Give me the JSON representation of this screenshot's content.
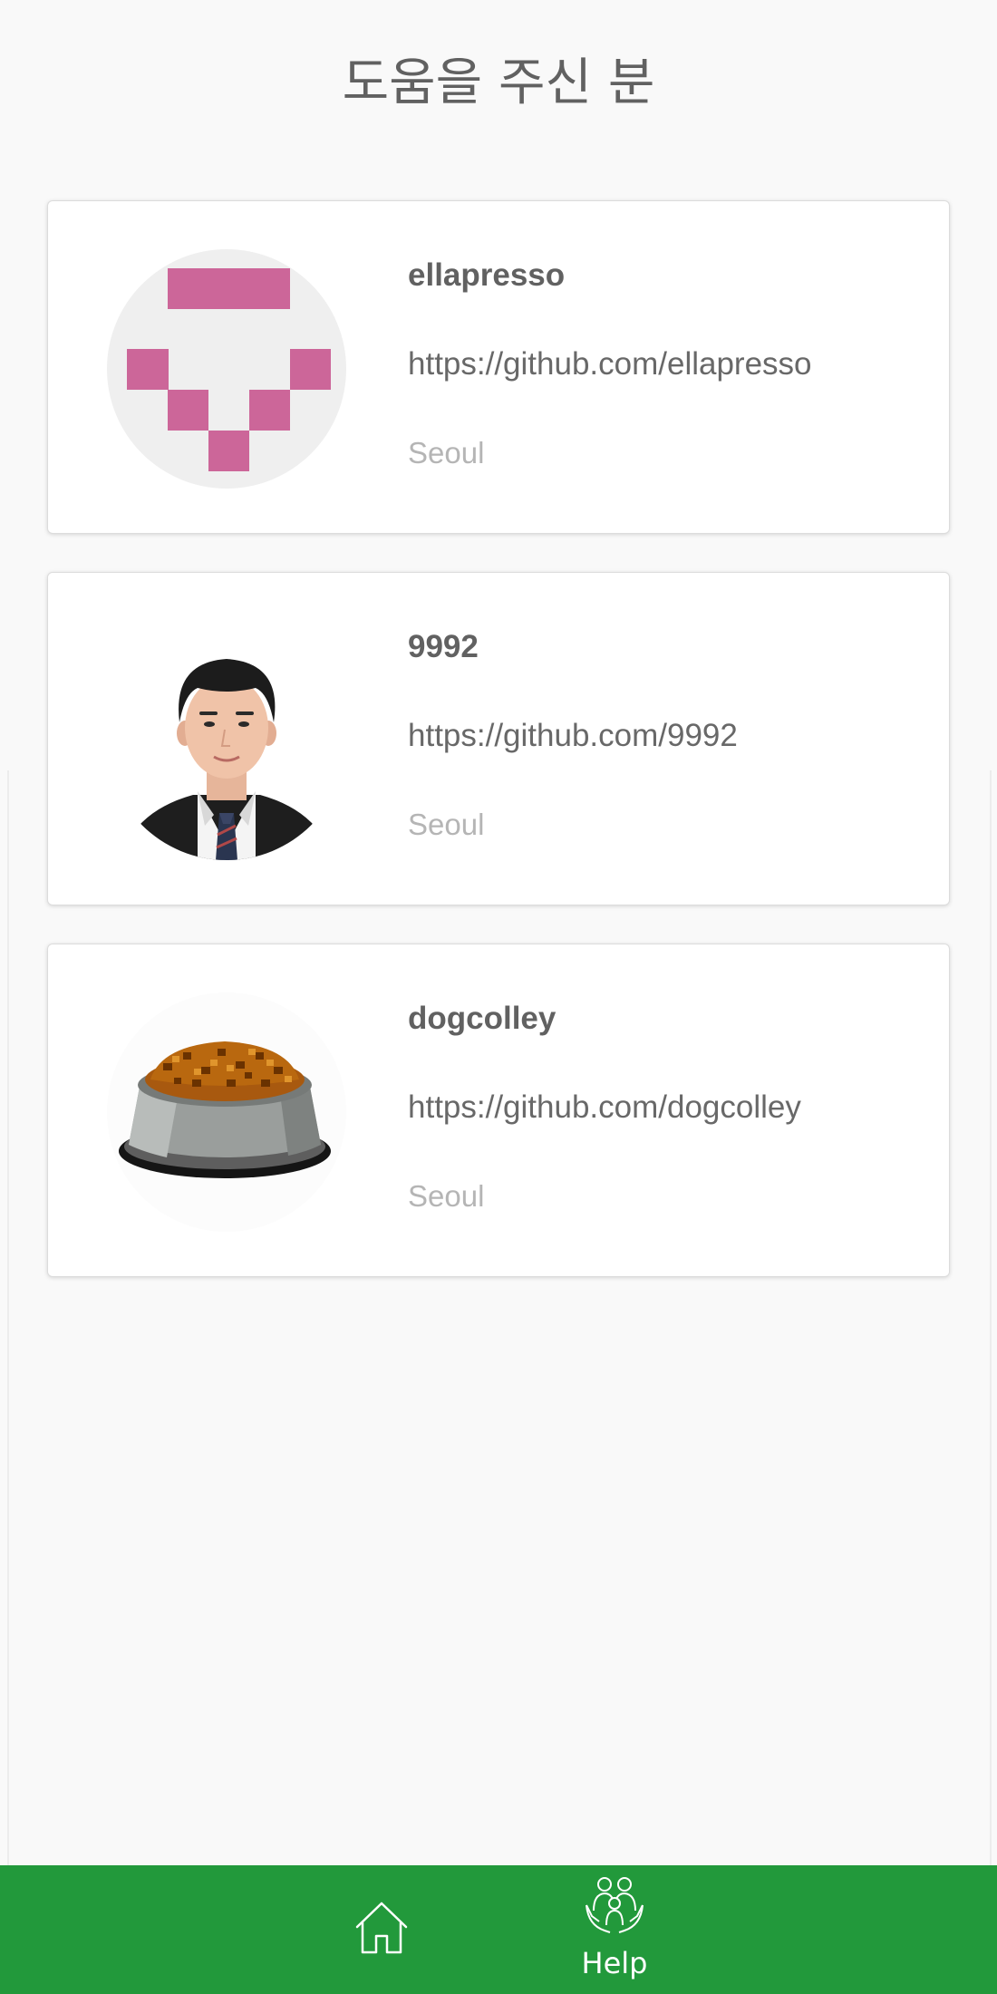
{
  "page": {
    "title": "도움을 주신 분"
  },
  "contributors": [
    {
      "username": "ellapresso",
      "url": "https://github.com/ellapresso",
      "location": "Seoul",
      "avatar": "identicon-avatar"
    },
    {
      "username": "9992",
      "url": "https://github.com/9992",
      "location": "Seoul",
      "avatar": "person-photo-avatar"
    },
    {
      "username": "dogcolley",
      "url": "https://github.com/dogcolley",
      "location": "Seoul",
      "avatar": "dog-food-bowl-avatar"
    }
  ],
  "nav": {
    "home_icon": "home-icon",
    "help_icon": "people-help-icon",
    "help_label": "Help"
  },
  "colors": {
    "nav_background": "#22993b",
    "identicon": "#cc6699",
    "background": "#f9f9f9"
  }
}
